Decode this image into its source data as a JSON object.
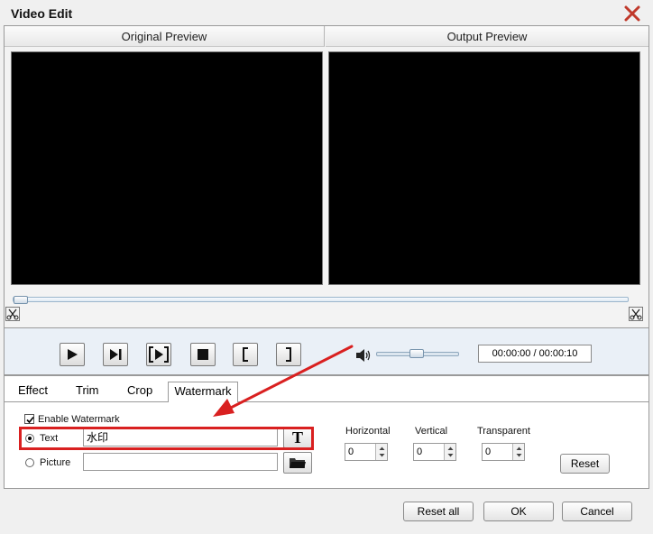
{
  "window": {
    "title": "Video Edit"
  },
  "preview": {
    "original_label": "Original Preview",
    "output_label": "Output Preview"
  },
  "playback": {
    "timecode": "00:00:00 / 00:00:10"
  },
  "tabs": [
    {
      "label": "Effect"
    },
    {
      "label": "Trim"
    },
    {
      "label": "Crop"
    },
    {
      "label": "Watermark"
    }
  ],
  "watermark": {
    "enable_label": "Enable Watermark",
    "enabled": true,
    "text_option_label": "Text",
    "text_value": "水印",
    "picture_option_label": "Picture",
    "picture_value": "",
    "horizontal_label": "Horizontal",
    "horizontal_value": "0",
    "vertical_label": "Vertical",
    "vertical_value": "0",
    "transparent_label": "Transparent",
    "transparent_value": "0",
    "reset_label": "Reset"
  },
  "footer": {
    "reset_all_label": "Reset all",
    "ok_label": "OK",
    "cancel_label": "Cancel"
  },
  "colors": {
    "highlight": "#d92020",
    "screen": "#000000"
  }
}
